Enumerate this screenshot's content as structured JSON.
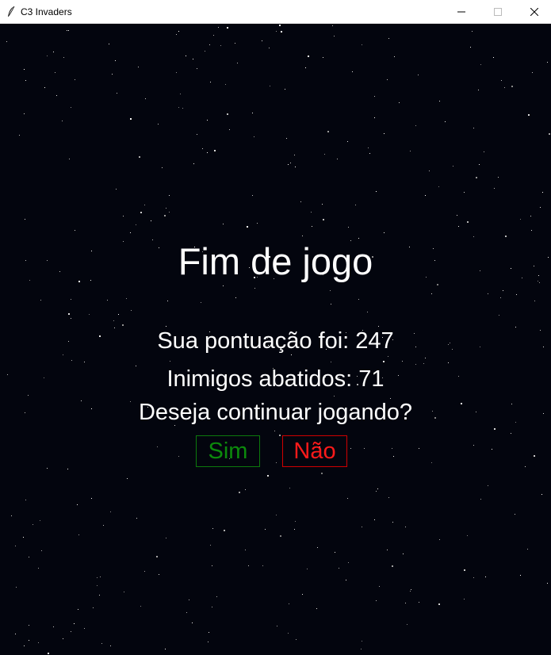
{
  "window": {
    "title": "C3 Invaders"
  },
  "game_over": {
    "title": "Fim de jogo",
    "score_text": "Sua pontuação foi: 247",
    "kills_text": "Inimigos abatidos: 71",
    "continue_prompt": "Deseja continuar jogando?",
    "yes_label": "Sim",
    "no_label": "Não"
  },
  "colors": {
    "background": "#03050e",
    "text": "#ffffff",
    "yes": "#0c8a0c",
    "no": "#ff1a1a"
  }
}
